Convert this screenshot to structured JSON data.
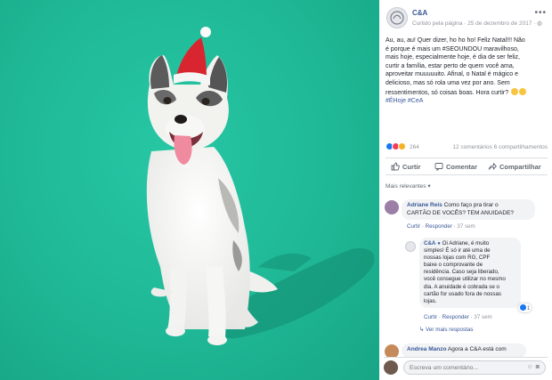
{
  "post": {
    "page_name": "C&A",
    "meta": "Curtido pela página · 25 de dezembro de 2017 · ",
    "body_lines": [
      "Au, au, au! Quer dizer, ho ho ho! Feliz Natal!!! Não",
      "é porque é mais um #SEOUNDOU maravilhoso,",
      "mais hoje, especialmente hoje, é dia de ser feliz,",
      "curtir a família, estar perto de quem você ama,",
      "aproveitar muuuuuito. Afinal, o Natal é mágico e",
      "delicioso, mas só rola uma vez por ano. Sem",
      "ressentimentos, só coisas boas. Hora curtir?"
    ],
    "hashtags": "#ÉHoje #CeA"
  },
  "reactions": {
    "count": "264",
    "summary": "12 comentários 6 compartilhamentos",
    "colors": [
      "#1877f2",
      "#f33e58",
      "#f7b125"
    ]
  },
  "actions": {
    "like": "Curtir",
    "comment": "Comentar",
    "share": "Compartilhar"
  },
  "relevance_label": "Mais relevantes",
  "comments": [
    {
      "author": "Adriane Reis",
      "text_lines": [
        "Como faço pra tirar o",
        "CARTÃO DE VOCÊS? TEM ANUIDADE?"
      ],
      "like": "Curtir",
      "reply": "Responder",
      "time": "37 sem"
    },
    {
      "author": "C&A",
      "text_lines": [
        "Oi Adriane, é muito",
        "simples! É só ir até uma de",
        "nossas lojas com RG, CPF",
        "baixe o comprovante de",
        "residência. Caso seja liberado,",
        "você consegue utilizar no mesmo",
        "dia. A anuidade é cobrada se o",
        "cartão for usado fora de nossas",
        "lojas."
      ],
      "likes": "1",
      "like": "Curtir",
      "reply": "Responder",
      "time": "37 sem"
    },
    {
      "author": "Andrea Manzo",
      "text_lines": [
        "Agora a C&A está com"
      ]
    }
  ],
  "more_replies": "Ver mais respostas",
  "compose": {
    "placeholder": "Escreva um comentário..."
  },
  "colors": {
    "background": "#1fb896",
    "link": "#385898"
  }
}
